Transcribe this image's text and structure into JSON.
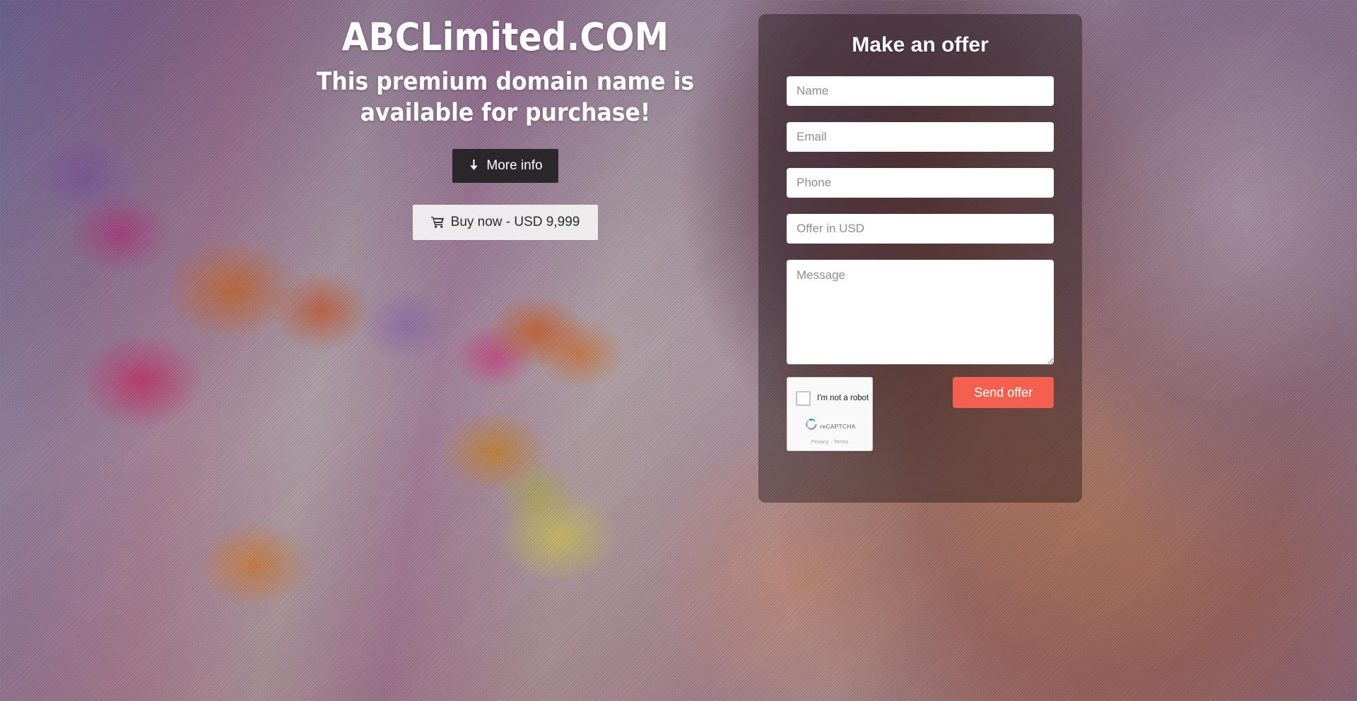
{
  "hero": {
    "domain_title": "ABCLimited.COM",
    "tagline": "This premium domain name is available for purchase!",
    "more_info_label": "More info",
    "more_info_icon": "arrow-down-icon",
    "buy_now_label": "Buy now - USD 9,999",
    "buy_now_icon": "shopping-cart-icon"
  },
  "offer_form": {
    "title": "Make an offer",
    "fields": {
      "name": {
        "placeholder": "Name",
        "value": ""
      },
      "email": {
        "placeholder": "Email",
        "value": ""
      },
      "phone": {
        "placeholder": "Phone",
        "value": ""
      },
      "offer": {
        "placeholder": "Offer in USD",
        "value": ""
      },
      "message": {
        "placeholder": "Message",
        "value": ""
      }
    },
    "recaptcha": {
      "checkbox_label": "I'm not a robot",
      "brand": "reCAPTCHA",
      "legal": "Privacy - Terms",
      "checked": false
    },
    "submit_label": "Send offer",
    "submit_color": "#f4604f"
  }
}
